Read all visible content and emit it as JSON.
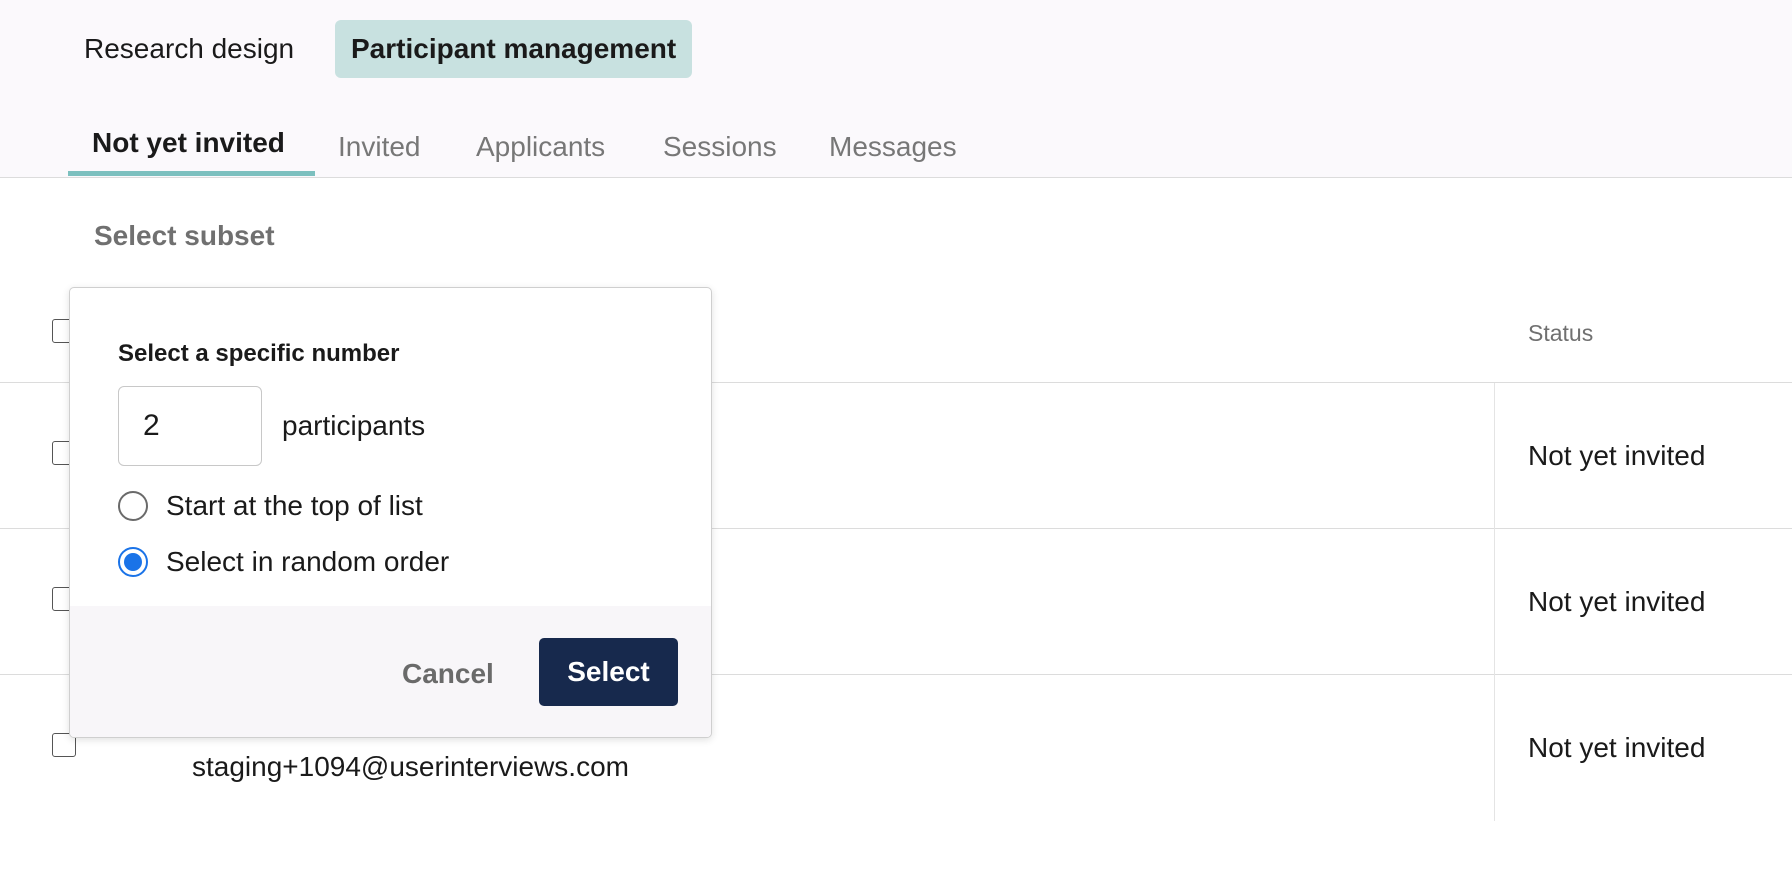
{
  "top_tabs": [
    {
      "label": "Research design"
    },
    {
      "label": "Participant management"
    }
  ],
  "sub_tabs": [
    {
      "label": "Not yet invited"
    },
    {
      "label": "Invited"
    },
    {
      "label": "Applicants"
    },
    {
      "label": "Sessions"
    },
    {
      "label": "Messages"
    }
  ],
  "subset_title": "Select subset",
  "table": {
    "status_header": "Status",
    "rows": [
      {
        "status": "Not yet invited"
      },
      {
        "status": "Not yet invited"
      },
      {
        "status": "Not yet invited",
        "email": "staging+1094@userinterviews.com"
      }
    ]
  },
  "popover": {
    "label": "Select a specific number",
    "number_value": "2",
    "number_suffix": "participants",
    "options": [
      {
        "label": "Start at the top of list",
        "checked": false
      },
      {
        "label": "Select in random order",
        "checked": true
      }
    ],
    "cancel_label": "Cancel",
    "select_label": "Select"
  },
  "colors": {
    "accent_tab": "#c8e1e0",
    "underline": "#7cc0bf",
    "primary_button": "#17294d",
    "radio_selected": "#1a73e8"
  }
}
